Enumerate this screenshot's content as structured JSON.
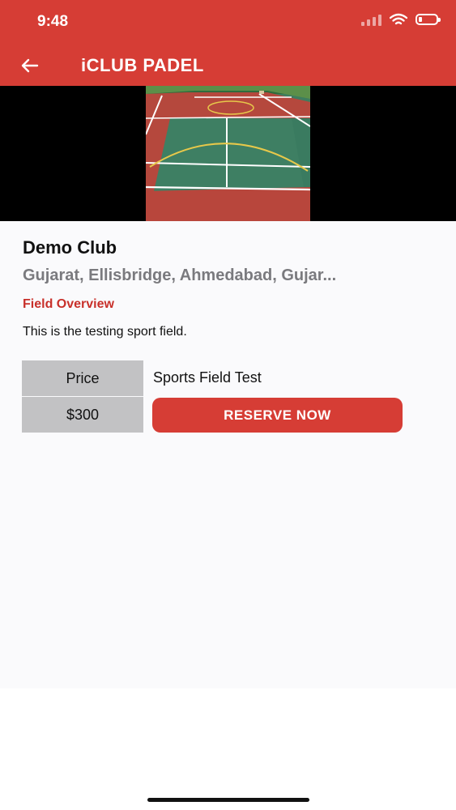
{
  "status_bar": {
    "time": "9:48",
    "battery_level": 0.2
  },
  "nav": {
    "title": "iCLUB PADEL",
    "back_icon": "arrow-left-icon"
  },
  "hero": {
    "image": "padel-court-photo"
  },
  "club": {
    "name": "Demo Club",
    "address": "Gujarat, Ellisbridge, Ahmedabad, Gujar...",
    "overview_title": "Field Overview",
    "overview_description": "This is the testing sport field."
  },
  "booking": {
    "price_label": "Price",
    "price_value": "$300",
    "field_name": "Sports Field Test",
    "reserve_label": "RESERVE NOW"
  },
  "colors": {
    "primary": "#d63d35",
    "accent_text": "#c8302a",
    "grey_cell": "#c2c2c4"
  }
}
